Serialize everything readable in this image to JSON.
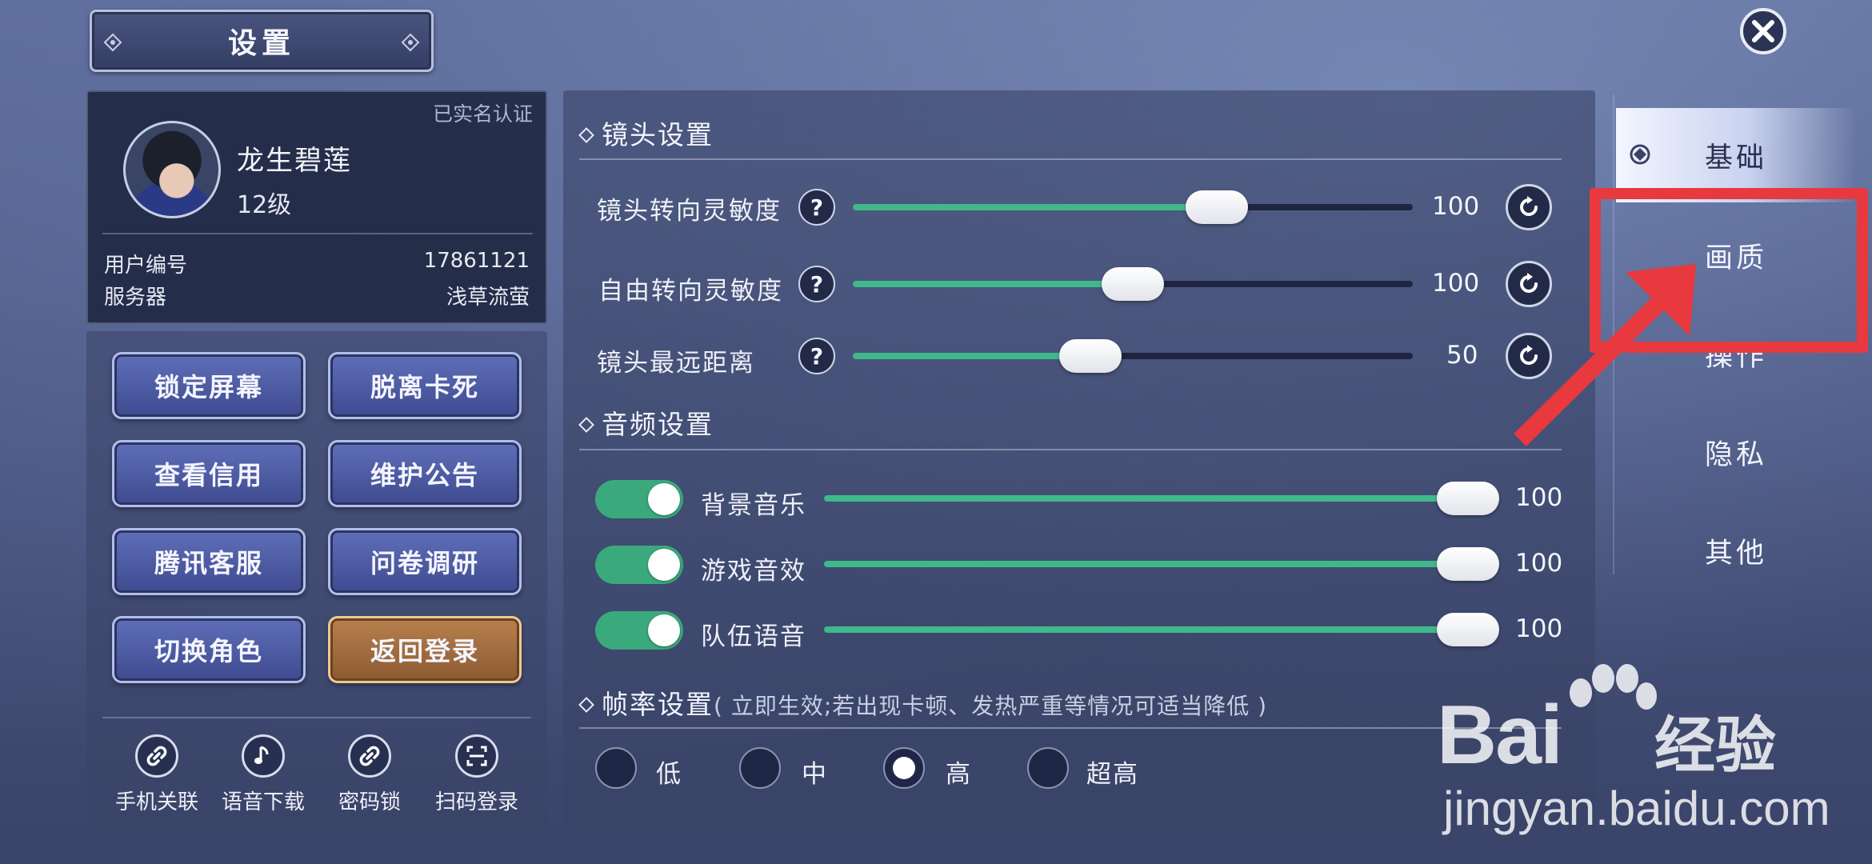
{
  "header": {
    "title": "设置"
  },
  "profile": {
    "verified_label": "已实名认证",
    "name": "龙生碧莲",
    "level": "12级",
    "user_id_label": "用户编号",
    "user_id": "17861121",
    "server_label": "服务器",
    "server": "浅草流萤"
  },
  "buttons": [
    {
      "label": "锁定屏幕",
      "style": "blue"
    },
    {
      "label": "脱离卡死",
      "style": "blue"
    },
    {
      "label": "查看信用",
      "style": "blue"
    },
    {
      "label": "维护公告",
      "style": "blue"
    },
    {
      "label": "腾讯客服",
      "style": "blue"
    },
    {
      "label": "问卷调研",
      "style": "blue"
    },
    {
      "label": "切换角色",
      "style": "blue"
    },
    {
      "label": "返回登录",
      "style": "orange"
    }
  ],
  "quick_actions": [
    {
      "label": "手机关联",
      "icon": "link-icon"
    },
    {
      "label": "语音下载",
      "icon": "music-note-icon"
    },
    {
      "label": "密码锁",
      "icon": "link-icon"
    },
    {
      "label": "扫码登录",
      "icon": "qr-scan-icon"
    }
  ],
  "camera": {
    "title": "镜头设置",
    "rows": [
      {
        "label": "镜头转向灵敏度",
        "value": "100",
        "fraction": 0.65
      },
      {
        "label": "自由转向灵敏度",
        "value": "100",
        "fraction": 0.5
      },
      {
        "label": "镜头最远距离",
        "value": "50",
        "fraction": 0.42
      }
    ]
  },
  "audio": {
    "title": "音频设置",
    "rows": [
      {
        "label": "背景音乐",
        "value": "100",
        "enabled": true,
        "fraction": 1.0
      },
      {
        "label": "游戏音效",
        "value": "100",
        "enabled": true,
        "fraction": 1.0
      },
      {
        "label": "队伍语音",
        "value": "100",
        "enabled": true,
        "fraction": 1.0
      }
    ]
  },
  "framerate": {
    "title": "帧率设置",
    "note": "( 立即生效;若出现卡顿、发热严重等情况可适当降低 )",
    "options": [
      "低",
      "中",
      "高",
      "超高"
    ],
    "selected": "高"
  },
  "tabs": [
    {
      "label": "基础",
      "active": true
    },
    {
      "label": "画质",
      "active": false
    },
    {
      "label": "操作",
      "active": false
    },
    {
      "label": "隐私",
      "active": false
    },
    {
      "label": "其他",
      "active": false
    }
  ],
  "watermark": {
    "brand": "Bai",
    "brand_cn": "经验",
    "url": "jingyan.baidu.com"
  },
  "colors": {
    "accent_green": "#3fb98a",
    "annotation_red": "#e8393f",
    "button_blue": "#4b58a2",
    "button_orange": "#a06a3d"
  }
}
